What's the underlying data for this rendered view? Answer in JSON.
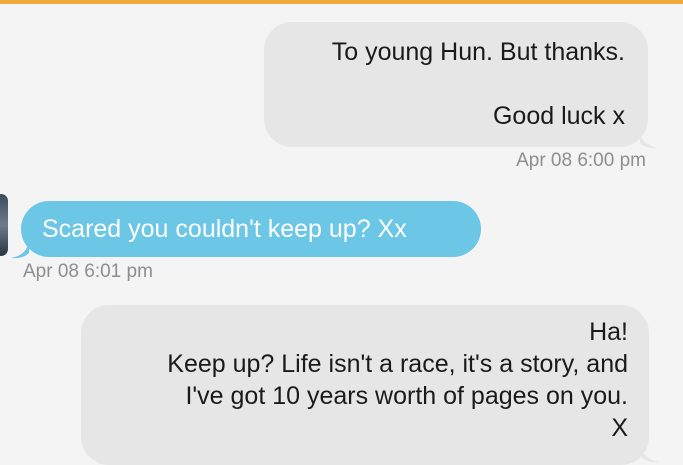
{
  "colors": {
    "background": "#f4f4f4",
    "accent_bar": "#f0a93a",
    "outgoing_bubble": "#e6e6e6",
    "incoming_bubble": "#6cc6e6",
    "timestamp": "#8e8e8e"
  },
  "messages": [
    {
      "direction": "outgoing",
      "lines": [
        "To young Hun. But thanks.",
        "",
        "Good luck x"
      ],
      "timestamp": "Apr 08 6:00 pm"
    },
    {
      "direction": "incoming",
      "lines": [
        "Scared you couldn't keep up? Xx"
      ],
      "timestamp": "Apr 08 6:01 pm"
    },
    {
      "direction": "outgoing",
      "lines": [
        "Ha!",
        "Keep up? Life isn't a race, it's a story, and",
        "I've got 10 years worth of pages on you.",
        "X"
      ]
    }
  ]
}
